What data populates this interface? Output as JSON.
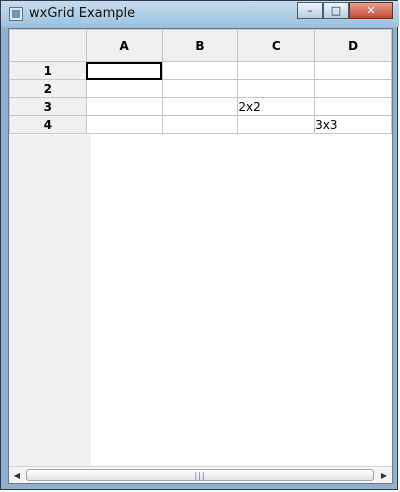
{
  "window": {
    "title": "wxGrid Example"
  },
  "titlebar_buttons": {
    "minimize": "–",
    "maximize": "□",
    "close": "✕"
  },
  "grid": {
    "columns": [
      "A",
      "B",
      "C",
      "D"
    ],
    "rows": [
      {
        "label": "1",
        "cells": [
          "",
          "",
          "",
          ""
        ]
      },
      {
        "label": "2",
        "cells": [
          "",
          "",
          "",
          ""
        ]
      },
      {
        "label": "3",
        "cells": [
          "",
          "",
          "2x2",
          ""
        ]
      },
      {
        "label": "4",
        "cells": [
          "",
          "",
          "",
          "3x3"
        ]
      }
    ]
  },
  "scrollbar": {
    "left": "◀",
    "right": "▶",
    "grip": "|||"
  }
}
